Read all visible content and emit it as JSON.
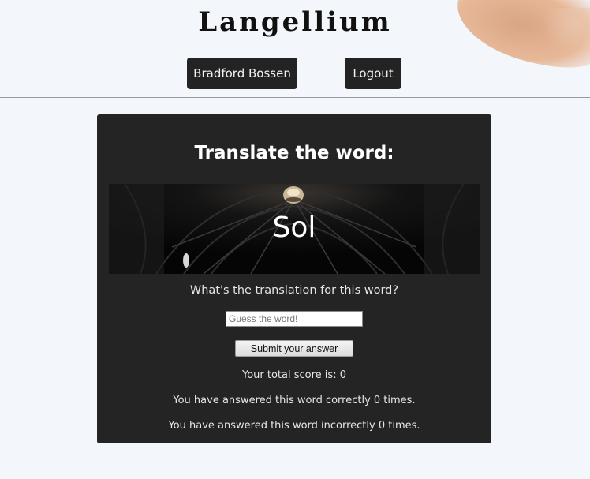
{
  "header": {
    "brand": "Langellium",
    "user_label": "Bradford Bossen",
    "logout_label": "Logout"
  },
  "card": {
    "title": "Translate the word:",
    "word": "Sol",
    "prompt": "What's the translation for this word?",
    "input_placeholder": "Guess the word!",
    "input_value": "",
    "submit_label": "Submit your answer",
    "score_text": "Your total score is: 0",
    "correct_text": "You have answered this word correctly 0 times.",
    "incorrect_text": "You have answered this word incorrectly 0 times."
  },
  "colors": {
    "page_bg": "#f3f6fb",
    "button_bg": "#232323",
    "card_bg": "#242424"
  }
}
